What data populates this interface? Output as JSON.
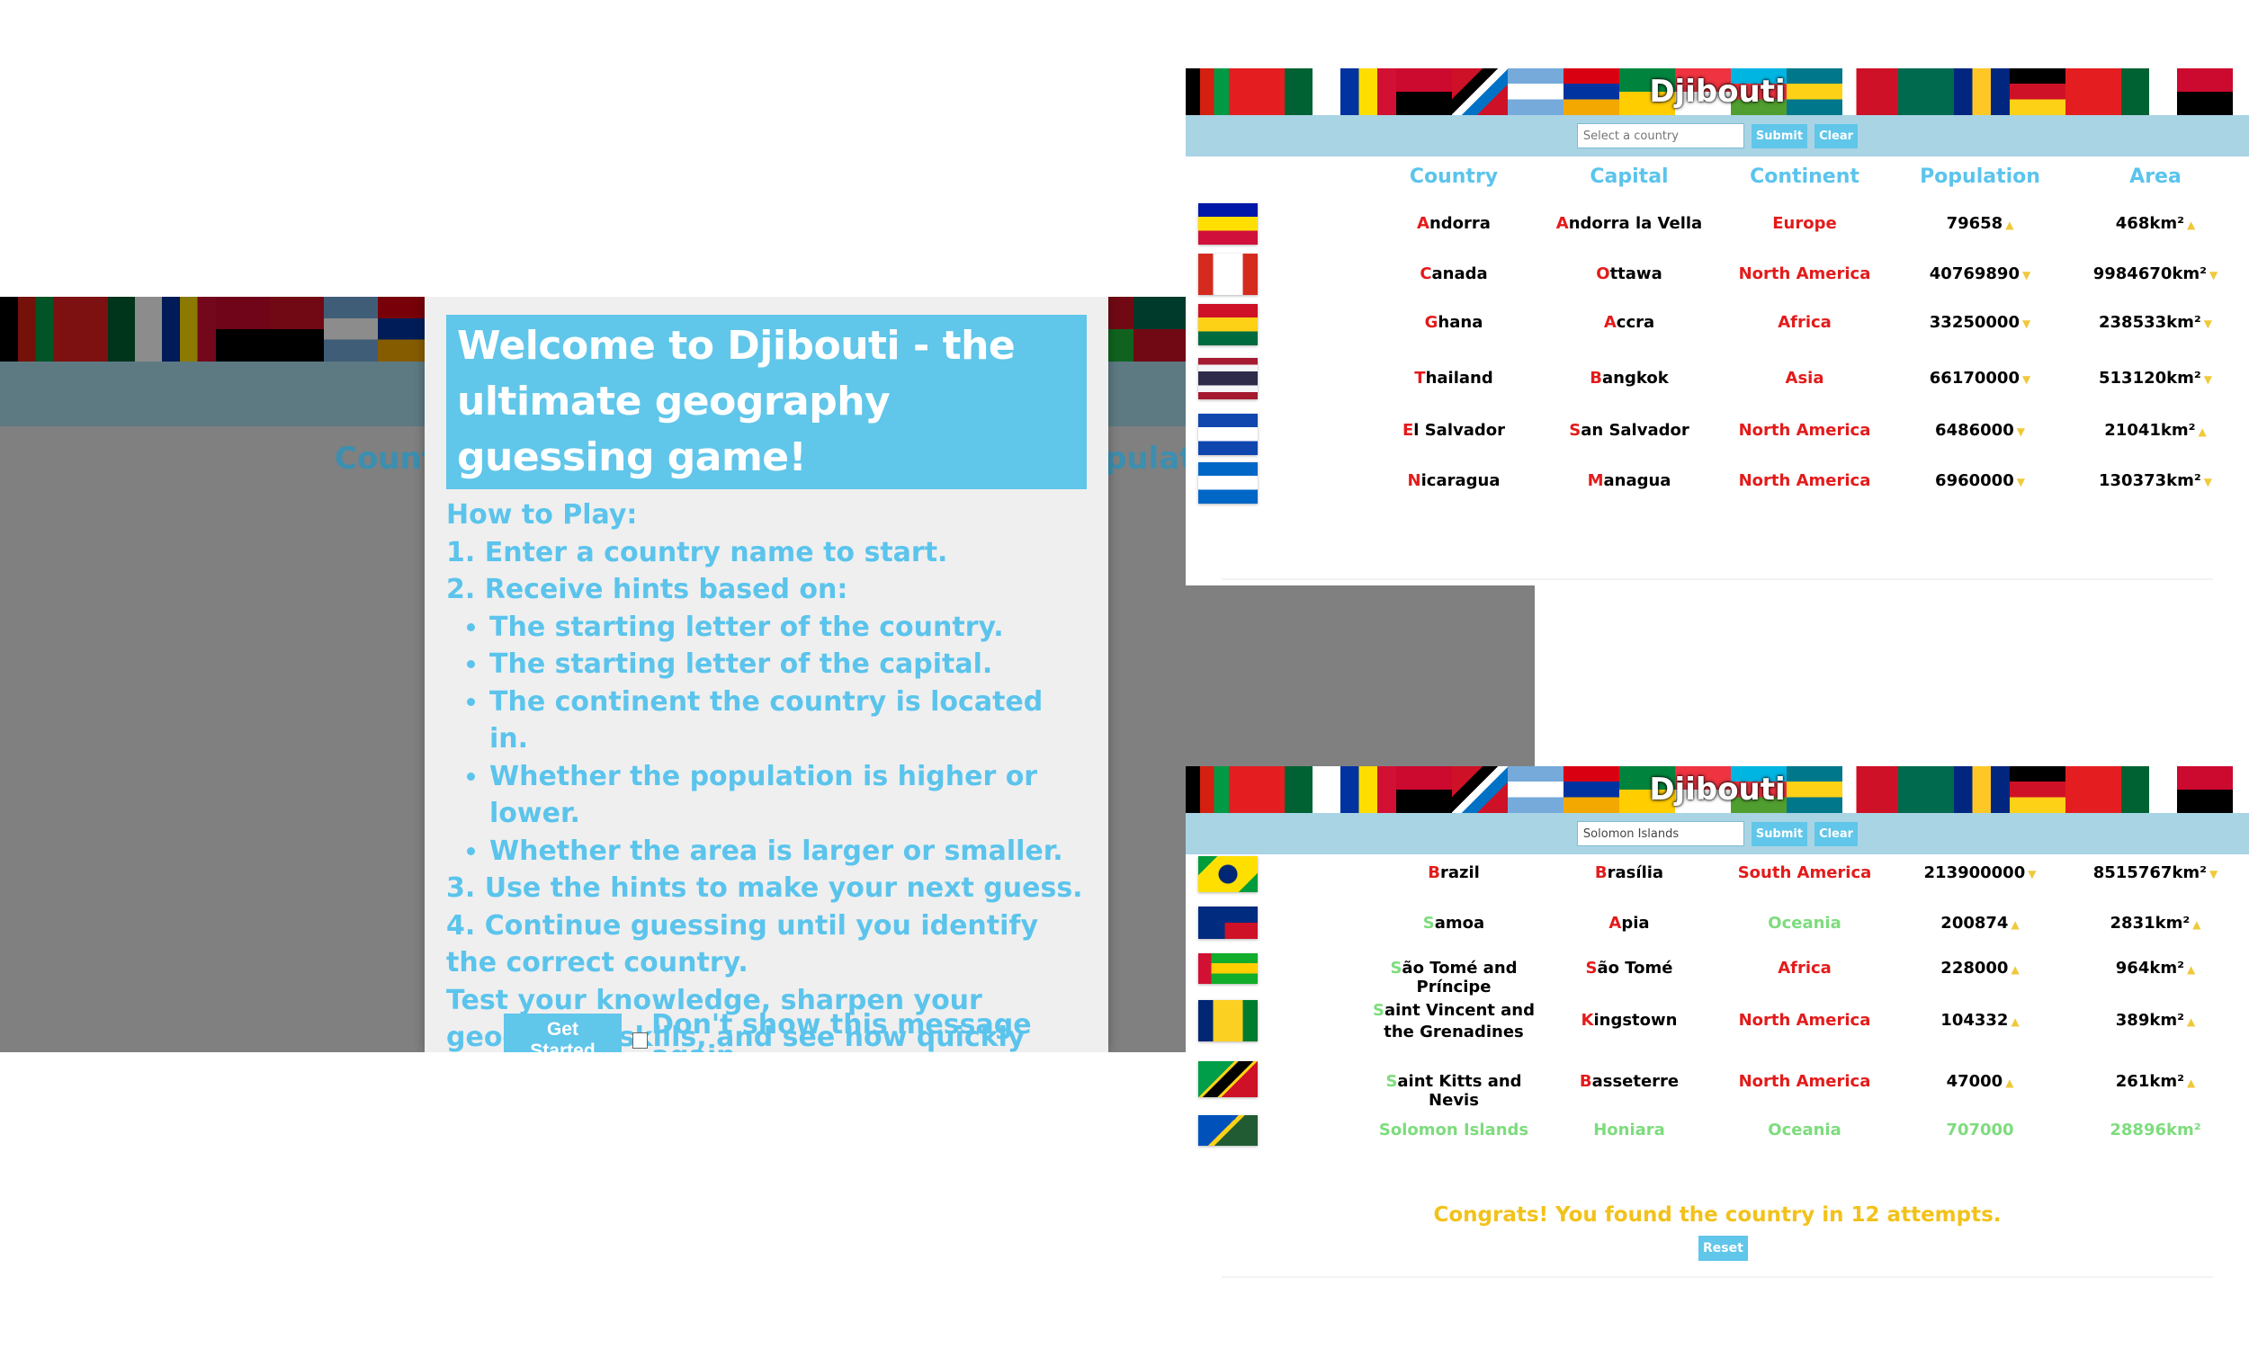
{
  "modal": {
    "title": "Welcome to Djibouti - the ultimate geography guessing game!",
    "how_to_play": "How to Play:",
    "step1": "1. Enter a country name to start.",
    "step2": "2. Receive hints based on:",
    "hints": [
      "The starting letter of the country.",
      "The starting letter of the capital.",
      "The continent the country is located in.",
      "Whether the population is higher or lower.",
      "Whether the area is larger or smaller."
    ],
    "step3": "3. Use the hints to make your next guess.",
    "step4": "4. Continue guessing until you identify the correct country.",
    "closing": "Test your knowledge, sharpen your geography skills, and see how quickly you can guess the right country. Good luck and have fun exploring the world with Djibouti.",
    "get_started": "Get Started",
    "dont_show": "Don't show this message again."
  },
  "background": {
    "country_header_partial": "Countr",
    "population_header_partial": "pulati"
  },
  "app": {
    "brand": "Djibouti",
    "submit": "Submit",
    "clear": "Clear",
    "placeholder": "Select a country",
    "bottom_input_value": "Solomon Islands",
    "columns": [
      "Country",
      "Capital",
      "Continent",
      "Population",
      "Area"
    ],
    "top_rows": [
      {
        "country_first": "A",
        "country_rest": "ndorra",
        "capital_first": "A",
        "capital_rest": "ndorra la Vella",
        "continent": "Europe",
        "population": "79658",
        "area": "468km²"
      },
      {
        "country_first": "C",
        "country_rest": "anada",
        "capital_first": "O",
        "capital_rest": "ttawa",
        "continent": "North America",
        "population": "40769890",
        "area": "9984670km²"
      },
      {
        "country_first": "G",
        "country_rest": "hana",
        "capital_first": "A",
        "capital_rest": "ccra",
        "continent": "Africa",
        "population": "33250000",
        "area": "238533km²"
      },
      {
        "country_first": "T",
        "country_rest": "hailand",
        "capital_first": "B",
        "capital_rest": "angkok",
        "continent": "Asia",
        "population": "66170000",
        "area": "513120km²"
      },
      {
        "country_first": "E",
        "country_rest": "l Salvador",
        "capital_first": "S",
        "capital_rest": "an Salvador",
        "continent": "North America",
        "population": "6486000",
        "area": "21041km²"
      },
      {
        "country_first": "N",
        "country_rest": "icaragua",
        "capital_first": "M",
        "capital_rest": "anagua",
        "continent": "North America",
        "population": "6960000",
        "area": "130373km²"
      }
    ],
    "bottom_rows": [
      {
        "country_first": "B",
        "country_rest": "razil",
        "capital_first": "B",
        "capital_rest": "rasília",
        "continent": "South America",
        "population": "213900000",
        "area": "8515767km²"
      },
      {
        "country_first": "S",
        "country_rest": "amoa",
        "capital_first": "A",
        "capital_rest": "pia",
        "continent": "Oceania",
        "population": "200874",
        "area": "2831km²"
      },
      {
        "country_first": "S",
        "country_rest": "ão Tomé and Príncipe",
        "capital_first": "S",
        "capital_rest": "ão Tomé",
        "continent": "Africa",
        "population": "228000",
        "area": "964km²"
      },
      {
        "country_first": "S",
        "country_rest": "aint Vincent and the Grenadines",
        "capital_first": "K",
        "capital_rest": "ingstown",
        "continent": "North America",
        "population": "104332",
        "area": "389km²"
      },
      {
        "country_first": "S",
        "country_rest": "aint Kitts and Nevis",
        "capital_first": "B",
        "capital_rest": "asseterre",
        "continent": "North America",
        "population": "47000",
        "area": "261km²"
      },
      {
        "country": "Solomon Islands",
        "capital": "Honiara",
        "continent": "Oceania",
        "population": "707000",
        "area": "28896km²"
      }
    ],
    "congrats": "Congrats! You found the country in 12 attempts.",
    "reset": "Reset"
  },
  "colors": {
    "accent": "#60c6ea",
    "wrong": "#e31b1b",
    "correct": "#7ddc7d",
    "arrow": "#f0c93b",
    "congrats": "#f2c21b"
  }
}
